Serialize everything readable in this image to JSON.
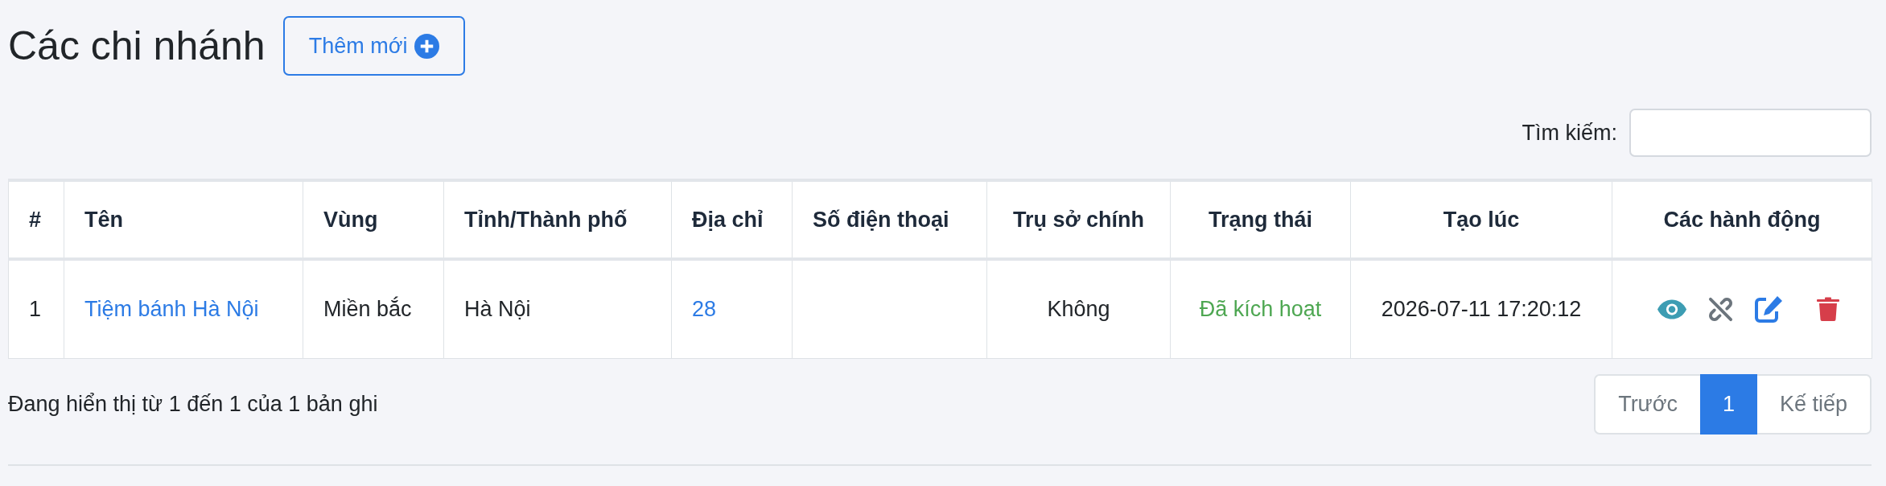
{
  "page": {
    "title": "Các chi nhánh",
    "add_button": {
      "label": "Thêm mới"
    }
  },
  "search": {
    "label": "Tìm kiếm:"
  },
  "table": {
    "columns": [
      "#",
      "Tên",
      "Vùng",
      "Tỉnh/Thành phố",
      "Địa chỉ",
      "Số điện thoại",
      "Trụ sở chính",
      "Trạng thái",
      "Tạo lúc",
      "Các hành động"
    ],
    "rows": [
      {
        "number": "1",
        "name": "Tiệm bánh Hà Nội",
        "region": "Miền bắc",
        "province": "Hà Nội",
        "address": "28",
        "headquarters": "Không",
        "status": {
          "label": "Đã kích hoạt",
          "active": true
        },
        "created_at": "2026-07-11 17:20:12",
        "actions": [
          {
            "kind": "view"
          },
          {
            "kind": "unlink"
          },
          {
            "kind": "edit"
          },
          {
            "kind": "delete"
          }
        ]
      }
    ]
  },
  "table_info": "Đang hiển thị từ 1 đến 1 của 1 bản ghi",
  "pagination": [
    {
      "label": "Trước",
      "selected": false,
      "disabled": true
    },
    {
      "label": "1",
      "selected": true,
      "disabled": false
    },
    {
      "label": "Kế tiếp",
      "selected": false,
      "disabled": true
    }
  ]
}
